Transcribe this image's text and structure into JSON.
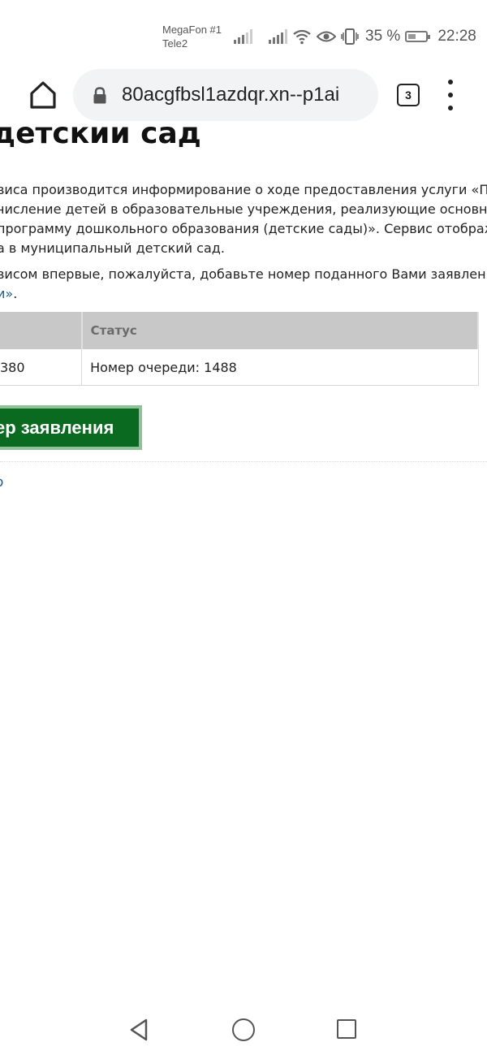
{
  "status_bar": {
    "carrier_1": "MegaFon #1",
    "carrier_2": "Tele2",
    "battery_percent": "35 %",
    "time": "22:28",
    "icons": [
      "signal-icon",
      "signal-icon",
      "wifi-icon",
      "eye-icon",
      "vibrate-icon",
      "battery-icon"
    ]
  },
  "browser": {
    "url": "80acgfbsl1azdqr.xn--p1ai",
    "tab_count": "3",
    "icons": [
      "home-icon",
      "lock-icon",
      "tabs-icon",
      "menu-icon"
    ]
  },
  "page": {
    "title": "детский сад",
    "paragraph_1": [
      "виса производится информирование о ходе предоставления услуги «Прием",
      "числение детей в образовательные учреждения, реализующие основную",
      "программу дошкольного образования (детские сады)». Сервис отображает п",
      "а в муниципальный детский сад."
    ],
    "paragraph_2_line_1": "висом впервые, пожалуйста, добавьте номер поданного Вами заявления на",
    "paragraph_2_link": "и»",
    "paragraph_2_end": ".",
    "table": {
      "headers": [
        "",
        "Статус"
      ],
      "rows": [
        [
          "380",
          "Номер очереди: 1488"
        ]
      ]
    },
    "add_button_label": "ер заявления",
    "bottom_link": "о"
  },
  "nav_bar": {
    "icons": [
      "back-icon",
      "home-circle-icon",
      "recent-apps-icon"
    ]
  }
}
